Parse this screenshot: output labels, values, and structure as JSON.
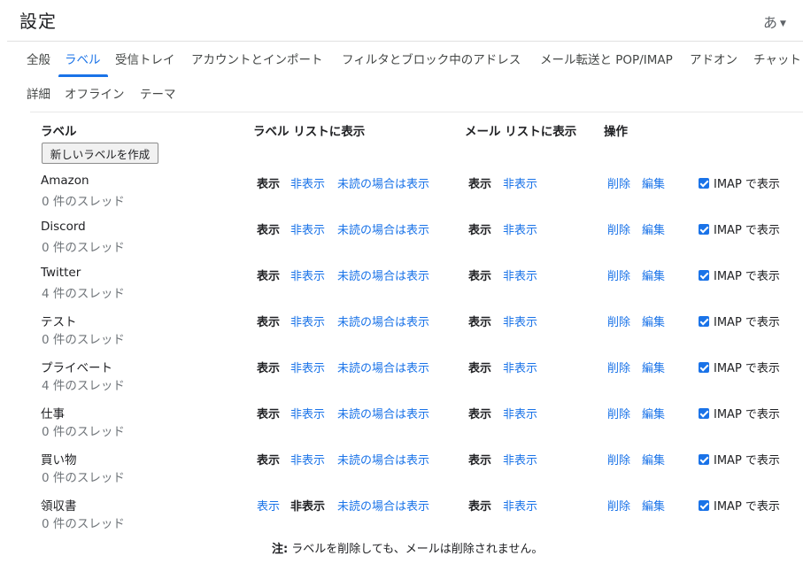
{
  "header": {
    "title": "設定",
    "input_indicator": "あ"
  },
  "tabs_row1": [
    {
      "label": "全般",
      "active": false
    },
    {
      "label": "ラベル",
      "active": true
    },
    {
      "label": "受信トレイ",
      "active": false
    },
    {
      "label": "アカウントとインポート",
      "active": false
    },
    {
      "label": "フィルタとブロック中のアドレス",
      "active": false
    },
    {
      "label": "メール転送と POP/IMAP",
      "active": false
    },
    {
      "label": "アドオン",
      "active": false
    },
    {
      "label": "チャット",
      "active": false
    }
  ],
  "tabs_row2": [
    {
      "label": "詳細",
      "active": false
    },
    {
      "label": "オフライン",
      "active": false
    },
    {
      "label": "テーマ",
      "active": false
    }
  ],
  "columns": {
    "label": "ラベル",
    "label_list": "ラベル リストに表示",
    "message_list": "メール リストに表示",
    "actions": "操作"
  },
  "create_button": "新しいラベルを作成",
  "labels": [
    {
      "name": "Amazon",
      "count": "0 件のスレッド",
      "list_show": "表示",
      "list_hide": "非表示",
      "list_unread": "未読の場合は表示",
      "list_selected": "show",
      "msg_show": "表示",
      "msg_hide": "非表示",
      "msg_selected": "show",
      "remove": "削除",
      "edit": "編集",
      "imap": "IMAP で表示",
      "imap_checked": true
    },
    {
      "name": "Discord",
      "count": "0 件のスレッド",
      "list_show": "表示",
      "list_hide": "非表示",
      "list_unread": "未読の場合は表示",
      "list_selected": "show",
      "msg_show": "表示",
      "msg_hide": "非表示",
      "msg_selected": "show",
      "remove": "削除",
      "edit": "編集",
      "imap": "IMAP で表示",
      "imap_checked": true
    },
    {
      "name": "Twitter",
      "count": "4 件のスレッド",
      "list_show": "表示",
      "list_hide": "非表示",
      "list_unread": "未読の場合は表示",
      "list_selected": "show",
      "msg_show": "表示",
      "msg_hide": "非表示",
      "msg_selected": "show",
      "remove": "削除",
      "edit": "編集",
      "imap": "IMAP で表示",
      "imap_checked": true
    },
    {
      "name": "テスト",
      "count": "0 件のスレッド",
      "list_show": "表示",
      "list_hide": "非表示",
      "list_unread": "未読の場合は表示",
      "list_selected": "show",
      "msg_show": "表示",
      "msg_hide": "非表示",
      "msg_selected": "show",
      "remove": "削除",
      "edit": "編集",
      "imap": "IMAP で表示",
      "imap_checked": true
    },
    {
      "name": "プライベート",
      "count": "4 件のスレッド",
      "list_show": "表示",
      "list_hide": "非表示",
      "list_unread": "未読の場合は表示",
      "list_selected": "show",
      "msg_show": "表示",
      "msg_hide": "非表示",
      "msg_selected": "show",
      "remove": "削除",
      "edit": "編集",
      "imap": "IMAP で表示",
      "imap_checked": true
    },
    {
      "name": "仕事",
      "count": "0 件のスレッド",
      "list_show": "表示",
      "list_hide": "非表示",
      "list_unread": "未読の場合は表示",
      "list_selected": "show",
      "msg_show": "表示",
      "msg_hide": "非表示",
      "msg_selected": "show",
      "remove": "削除",
      "edit": "編集",
      "imap": "IMAP で表示",
      "imap_checked": true
    },
    {
      "name": "買い物",
      "count": "0 件のスレッド",
      "list_show": "表示",
      "list_hide": "非表示",
      "list_unread": "未読の場合は表示",
      "list_selected": "show",
      "msg_show": "表示",
      "msg_hide": "非表示",
      "msg_selected": "show",
      "remove": "削除",
      "edit": "編集",
      "imap": "IMAP で表示",
      "imap_checked": true
    },
    {
      "name": "領収書",
      "count": "0 件のスレッド",
      "list_show": "表示",
      "list_hide": "非表示",
      "list_unread": "未読の場合は表示",
      "list_selected": "hide",
      "msg_show": "表示",
      "msg_hide": "非表示",
      "msg_selected": "show",
      "remove": "削除",
      "edit": "編集",
      "imap": "IMAP で表示",
      "imap_checked": true
    }
  ],
  "note": {
    "prefix": "注:",
    "text": "ラベルを削除しても、メールは削除されません。"
  },
  "colors": {
    "link": "#1a73e8",
    "text": "#202124",
    "muted": "#70757a"
  }
}
